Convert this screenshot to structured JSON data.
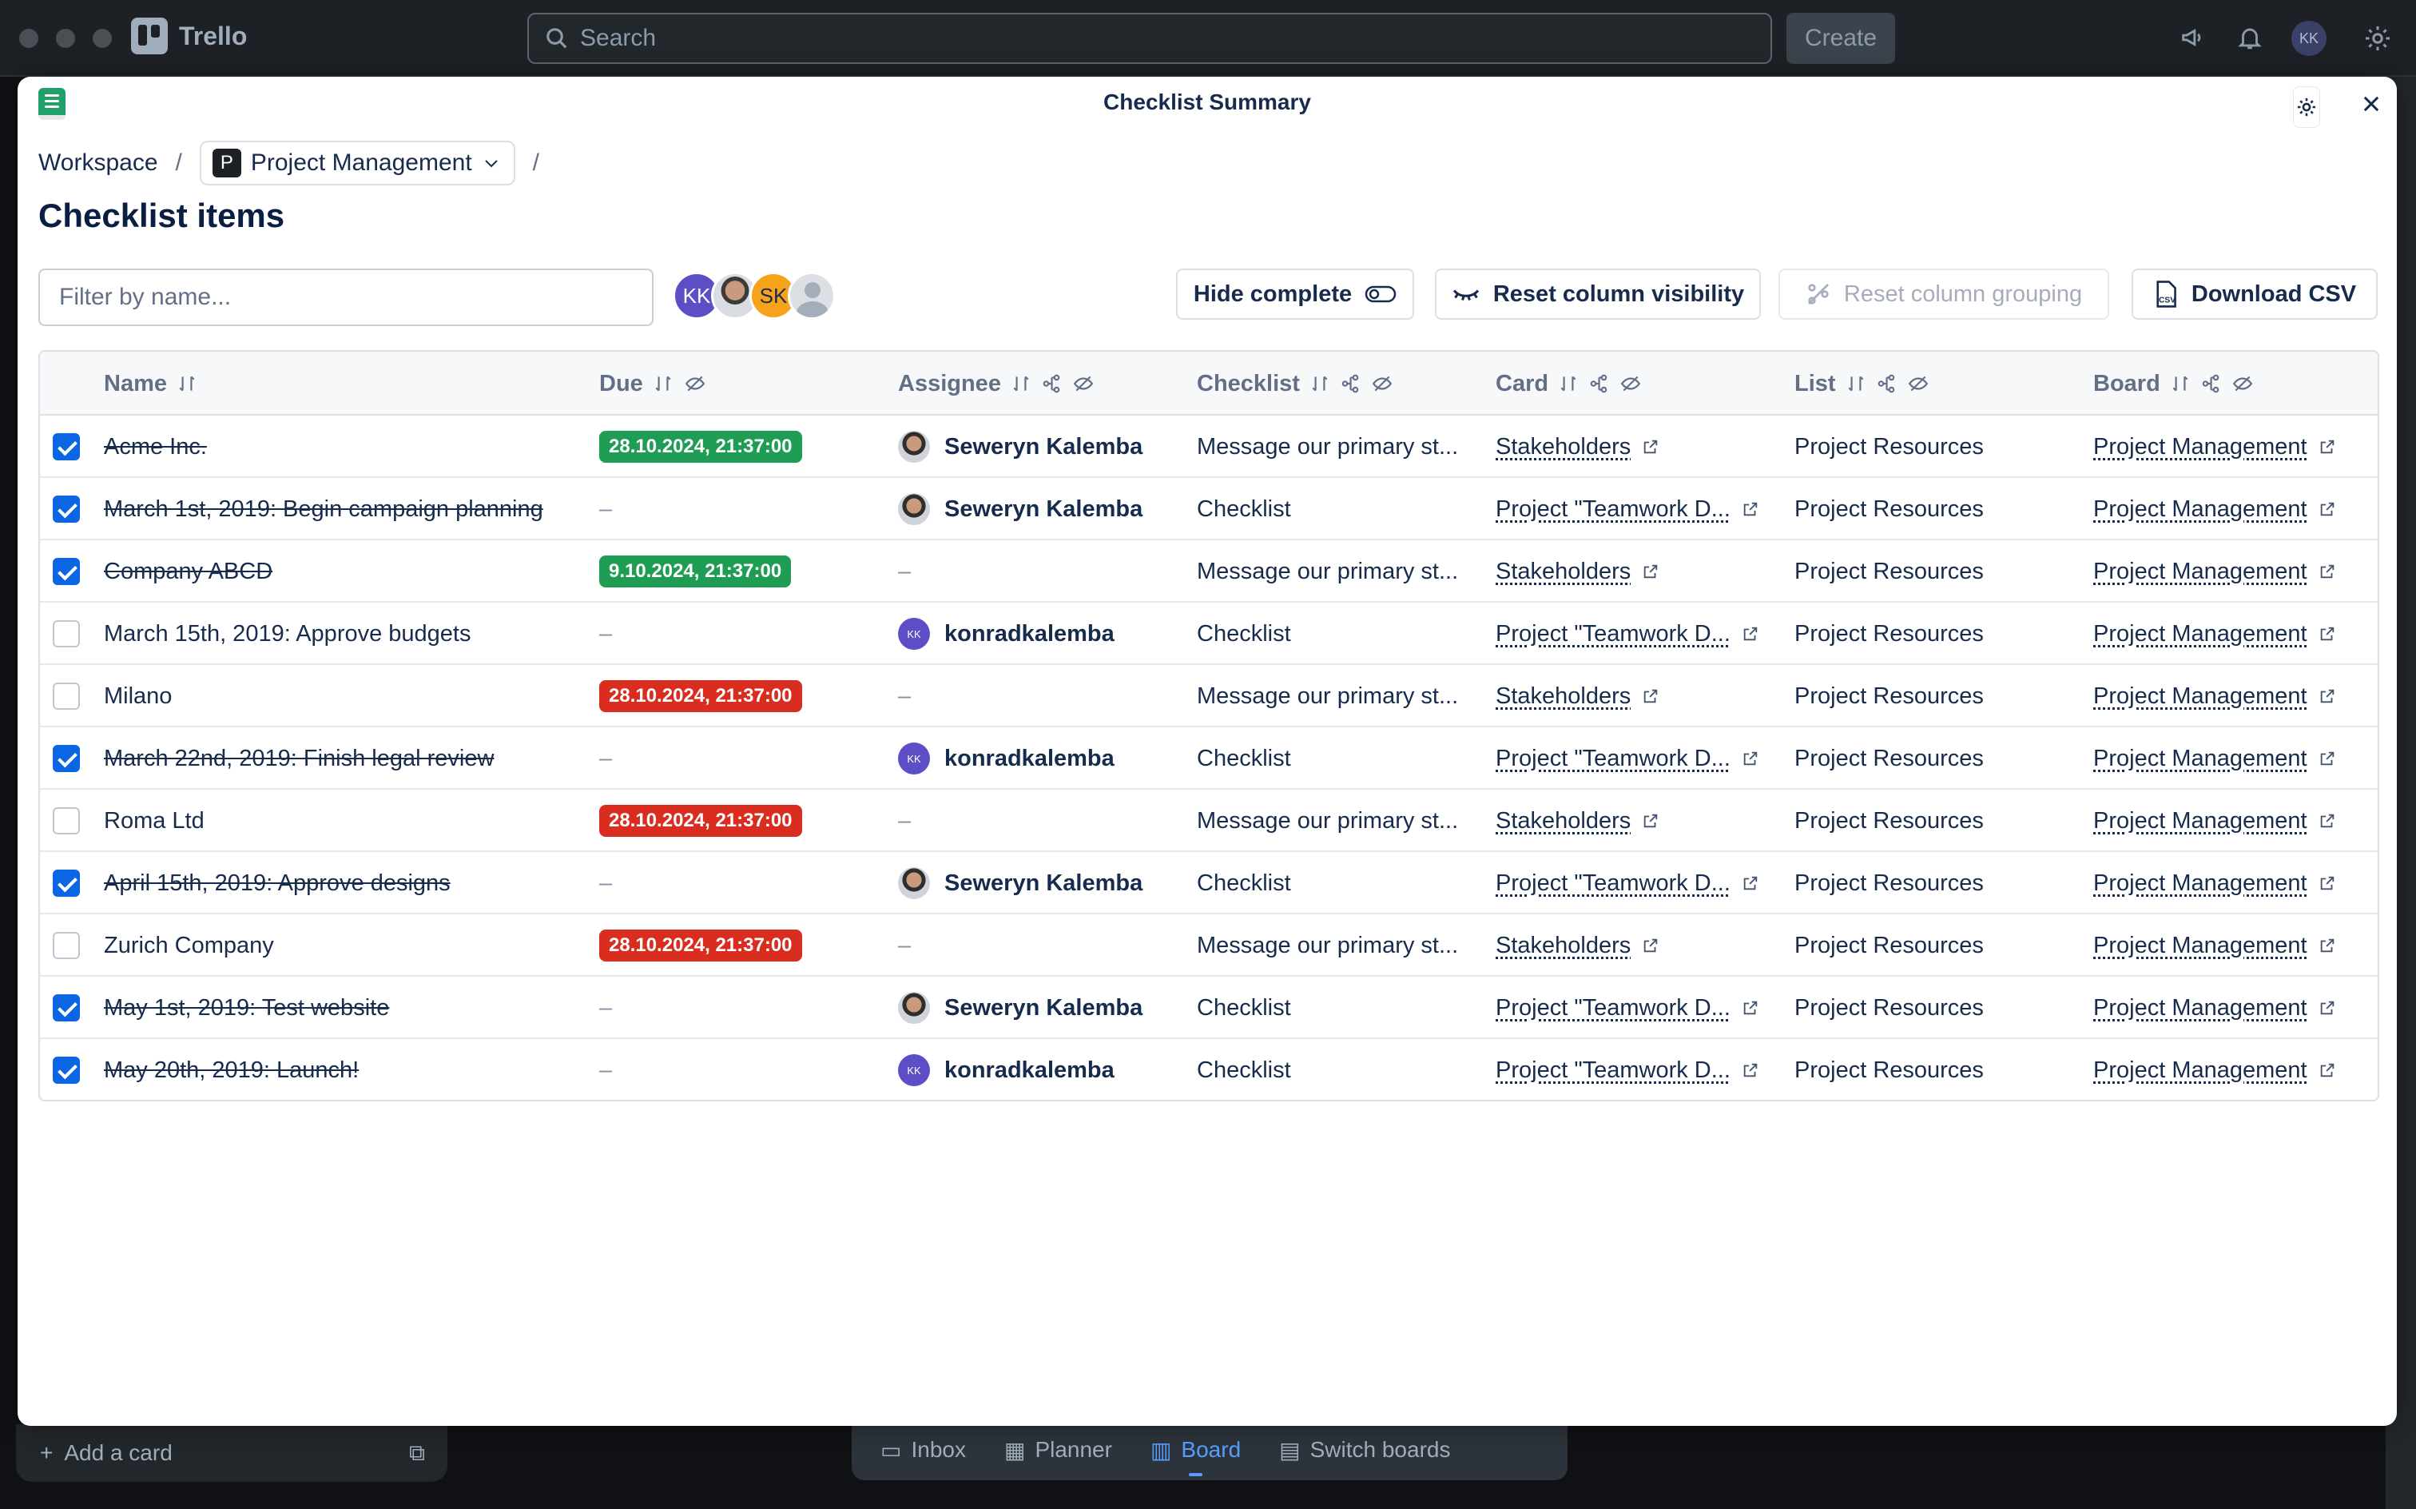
{
  "app": {
    "name": "Trello",
    "search_placeholder": "Search",
    "create_label": "Create",
    "user_initials": "KK"
  },
  "background": {
    "add_card_label": "Add a card",
    "bottom_nav": [
      "Inbox",
      "Planner",
      "Board",
      "Switch boards"
    ]
  },
  "modal": {
    "title": "Checklist Summary",
    "breadcrumb": {
      "workspace": "Workspace",
      "board": "Project Management",
      "board_badge": "P",
      "separator": "/"
    },
    "page_title": "Checklist items",
    "filter_placeholder": "Filter by name...",
    "filter_avatars": [
      "KK",
      "SK"
    ],
    "buttons": {
      "hide_complete": "Hide complete",
      "reset_visibility": "Reset column visibility",
      "reset_grouping": "Reset column grouping",
      "download_csv": "Download CSV"
    }
  },
  "table": {
    "columns": [
      "Name",
      "Due",
      "Assignee",
      "Checklist",
      "Card",
      "List",
      "Board"
    ],
    "rows": [
      {
        "done": true,
        "name": "Acme Inc.",
        "due": "28.10.2024, 21:37:00",
        "due_color": "green",
        "assignee": "Seweryn Kalemba",
        "avatar": "photo",
        "checklist": "Message our primary st...",
        "card": "Stakeholders",
        "list": "Project Resources",
        "board": "Project Management"
      },
      {
        "done": true,
        "name": "March 1st, 2019: Begin campaign planning",
        "due": "–",
        "due_color": "",
        "assignee": "Seweryn Kalemba",
        "avatar": "photo",
        "checklist": "Checklist",
        "card": "Project \"Teamwork D...",
        "list": "Project Resources",
        "board": "Project Management"
      },
      {
        "done": true,
        "name": "Company ABCD",
        "due": "9.10.2024, 21:37:00",
        "due_color": "green",
        "assignee": "–",
        "avatar": "",
        "checklist": "Message our primary st...",
        "card": "Stakeholders",
        "list": "Project Resources",
        "board": "Project Management"
      },
      {
        "done": false,
        "name": "March 15th, 2019: Approve budgets",
        "due": "–",
        "due_color": "",
        "assignee": "konradkalemba",
        "avatar": "KK",
        "checklist": "Checklist",
        "card": "Project \"Teamwork D...",
        "list": "Project Resources",
        "board": "Project Management"
      },
      {
        "done": false,
        "name": "Milano",
        "due": "28.10.2024, 21:37:00",
        "due_color": "red",
        "assignee": "–",
        "avatar": "",
        "checklist": "Message our primary st...",
        "card": "Stakeholders",
        "list": "Project Resources",
        "board": "Project Management"
      },
      {
        "done": true,
        "name": "March 22nd, 2019: Finish legal review",
        "due": "–",
        "due_color": "",
        "assignee": "konradkalemba",
        "avatar": "KK",
        "checklist": "Checklist",
        "card": "Project \"Teamwork D...",
        "list": "Project Resources",
        "board": "Project Management"
      },
      {
        "done": false,
        "name": "Roma Ltd",
        "due": "28.10.2024, 21:37:00",
        "due_color": "red",
        "assignee": "–",
        "avatar": "",
        "checklist": "Message our primary st...",
        "card": "Stakeholders",
        "list": "Project Resources",
        "board": "Project Management"
      },
      {
        "done": true,
        "name": "April 15th, 2019: Approve designs",
        "due": "–",
        "due_color": "",
        "assignee": "Seweryn Kalemba",
        "avatar": "photo",
        "checklist": "Checklist",
        "card": "Project \"Teamwork D...",
        "list": "Project Resources",
        "board": "Project Management"
      },
      {
        "done": false,
        "name": "Zurich Company",
        "due": "28.10.2024, 21:37:00",
        "due_color": "red",
        "assignee": "–",
        "avatar": "",
        "checklist": "Message our primary st...",
        "card": "Stakeholders",
        "list": "Project Resources",
        "board": "Project Management"
      },
      {
        "done": true,
        "name": "May 1st, 2019: Test website",
        "due": "–",
        "due_color": "",
        "assignee": "Seweryn Kalemba",
        "avatar": "photo",
        "checklist": "Checklist",
        "card": "Project \"Teamwork D...",
        "list": "Project Resources",
        "board": "Project Management"
      },
      {
        "done": true,
        "name": "May 20th, 2019: Launch!",
        "due": "–",
        "due_color": "",
        "assignee": "konradkalemba",
        "avatar": "KK",
        "checklist": "Checklist",
        "card": "Project \"Teamwork D...",
        "list": "Project Resources",
        "board": "Project Management"
      }
    ]
  },
  "colors": {
    "accent": "#0c66e4",
    "due_green": "#1f9d55",
    "due_red": "#d92d20",
    "logo_green": "#22a06b"
  }
}
